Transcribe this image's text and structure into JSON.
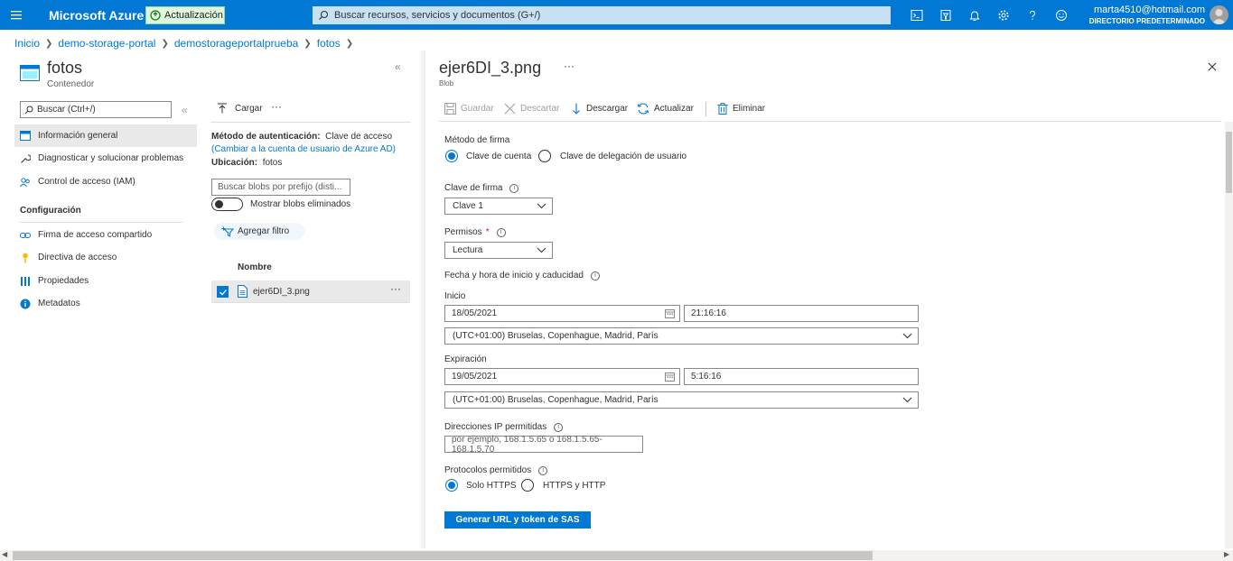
{
  "topbar": {
    "brand": "Microsoft Azure",
    "update_badge": "Actualización",
    "search_placeholder": "Buscar recursos, servicios y documentos (G+/)",
    "account_email": "marta4510@hotmail.com",
    "account_directory": "DIRECTORIO PREDETERMINADO"
  },
  "breadcrumb": [
    "Inicio",
    "demo-storage-portal",
    "demostorageportalprueba",
    "fotos"
  ],
  "left": {
    "title": "fotos",
    "subtitle": "Contenedor",
    "search_placeholder": "Buscar (Ctrl+/)",
    "menu_items": [
      "Información general",
      "Diagnosticar y solucionar problemas",
      "Control de acceso (IAM)"
    ],
    "section": "Configuración",
    "settings_items": [
      "Firma de acceso compartido",
      "Directiva de acceso",
      "Propiedades",
      "Metadatos"
    ]
  },
  "middle": {
    "upload": "Cargar",
    "auth_label": "Método de autenticación:",
    "auth_value": "Clave de acceso",
    "auth_link": "(Cambiar a la cuenta de usuario de Azure AD)",
    "location_label": "Ubicación:",
    "location_value": "fotos",
    "blob_search_placeholder": "Buscar blobs por prefijo (disti...",
    "show_deleted": "Mostrar blobs eliminados",
    "add_filter": "Agregar filtro",
    "column_name": "Nombre",
    "blobs": [
      "ejer6DI_3.png"
    ]
  },
  "panel": {
    "title": "ejer6DI_3.png",
    "subtitle": "Blob",
    "toolbar": {
      "save": "Guardar",
      "discard": "Descartar",
      "download": "Descargar",
      "refresh": "Actualizar",
      "delete": "Eliminar"
    },
    "signing_method_label": "Método de firma",
    "signing_options": [
      "Clave de cuenta",
      "Clave de delegación de usuario"
    ],
    "signing_key_label": "Clave de firma",
    "signing_key_value": "Clave 1",
    "permissions_label": "Permisos",
    "permissions_required": "*",
    "permissions_value": "Lectura",
    "datetime_label": "Fecha y hora de inicio y caducidad",
    "start_label": "Inicio",
    "start_date": "18/05/2021",
    "start_time": "21:16:16",
    "start_tz": "(UTC+01:00) Bruselas, Copenhague, Madrid, París",
    "expiry_label": "Expiración",
    "expiry_date": "19/05/2021",
    "expiry_time": "5:16:16",
    "expiry_tz": "(UTC+01:00) Bruselas, Copenhague, Madrid, París",
    "ip_label": "Direcciones IP permitidas",
    "ip_placeholder": "por ejemplo, 168.1.5.65 o 168.1.5.65-168.1.5.70",
    "protocols_label": "Protocolos permitidos",
    "protocol_options": [
      "Solo HTTPS",
      "HTTPS y HTTP"
    ],
    "generate_button": "Generar URL y token de SAS"
  },
  "colors": {
    "accent": "#0078d4",
    "badge_bg": "#dff6dd",
    "selected_row": "#e9e9e9",
    "required": "#a4262c"
  }
}
